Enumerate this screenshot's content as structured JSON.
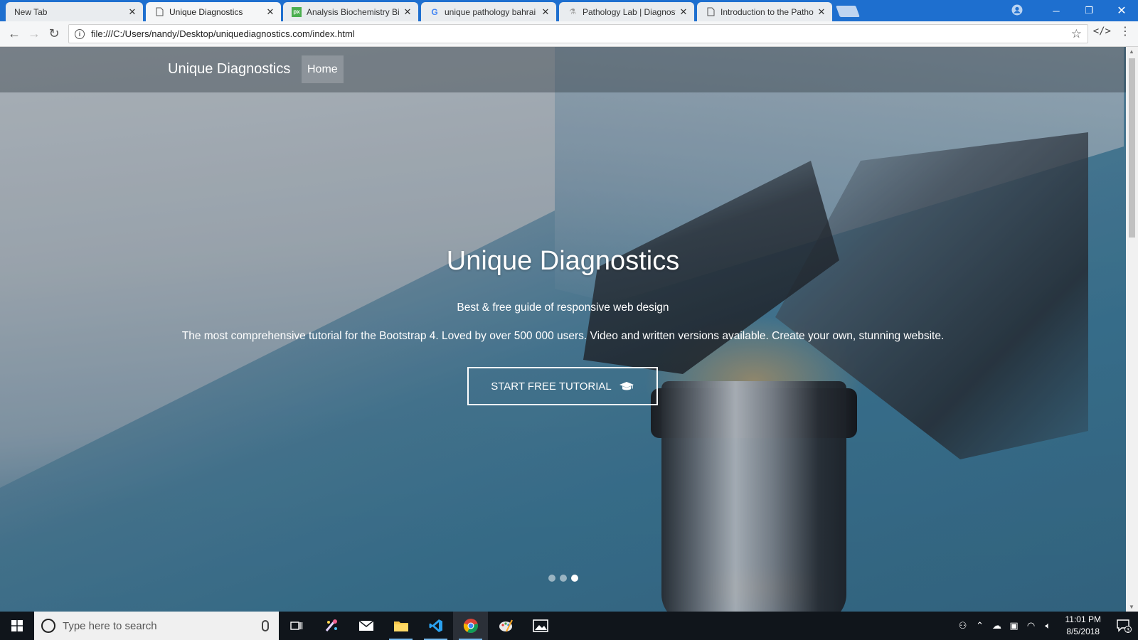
{
  "browser": {
    "tabs": [
      {
        "title": "New Tab",
        "active": false
      },
      {
        "title": "Unique Diagnostics",
        "active": true
      },
      {
        "title": "Analysis Biochemistry Bio",
        "active": false
      },
      {
        "title": "unique pathology bahrai",
        "active": false
      },
      {
        "title": "Pathology Lab | Diagnost",
        "active": false
      },
      {
        "title": "Introduction to the Patho",
        "active": false
      }
    ],
    "url": "file:///C:/Users/nandy/Desktop/uniquediagnostics.com/index.html",
    "accent": "#1e6fcf"
  },
  "site": {
    "brand": "Unique Diagnostics",
    "nav_home": "Home",
    "hero": {
      "title": "Unique Diagnostics",
      "subtitle": "Best & free guide of responsive web design",
      "description": "The most comprehensive tutorial for the Bootstrap 4. Loved by over 500 000 users. Video and written versions available. Create your own, stunning website.",
      "button_label": "START FREE TUTORIAL",
      "button_icon": "graduation-cap-icon"
    },
    "carousel": {
      "slide_count": 3,
      "active_slide": 3
    }
  },
  "taskbar": {
    "search_placeholder": "Type here to search",
    "clock_time": "11:01 PM",
    "clock_date": "8/5/2018",
    "notification_count": "3"
  }
}
